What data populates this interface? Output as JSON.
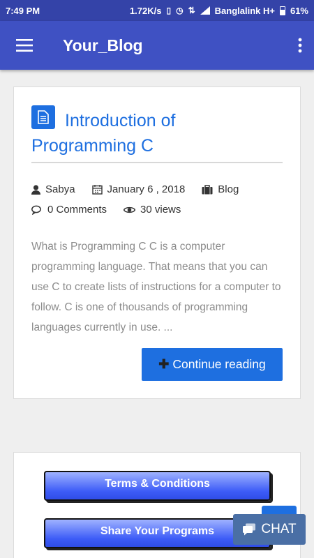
{
  "status_bar": {
    "time": "7:49 PM",
    "network_speed": "1.72K/s",
    "carrier": "Banglalink H+",
    "battery": "61%"
  },
  "app_bar": {
    "title": "Your_Blog",
    "menu_icon": "hamburger-menu-icon",
    "more_icon": "more-vertical-icon"
  },
  "post": {
    "title": "Introduction of Programming C",
    "author": "Sabya",
    "date": "January 6 , 2018",
    "category": "Blog",
    "comments": "0 Comments",
    "views": "30 views",
    "excerpt": "What is Programming C C is a computer programming language. That means that you can use C to create lists of instructions for a computer to follow. C is one of thousands of programming languages currently in use. ...",
    "continue_label": "Continue reading",
    "accent_color": "#1e6fe0"
  },
  "links": {
    "terms_label": "Terms & Conditions",
    "share_label": "Share Your Programs"
  },
  "chat": {
    "label": "CHAT",
    "color": "#4a6fa5"
  },
  "colors": {
    "status_bar": "#3443a8",
    "app_bar": "#3f51c3",
    "background": "#efefef"
  }
}
